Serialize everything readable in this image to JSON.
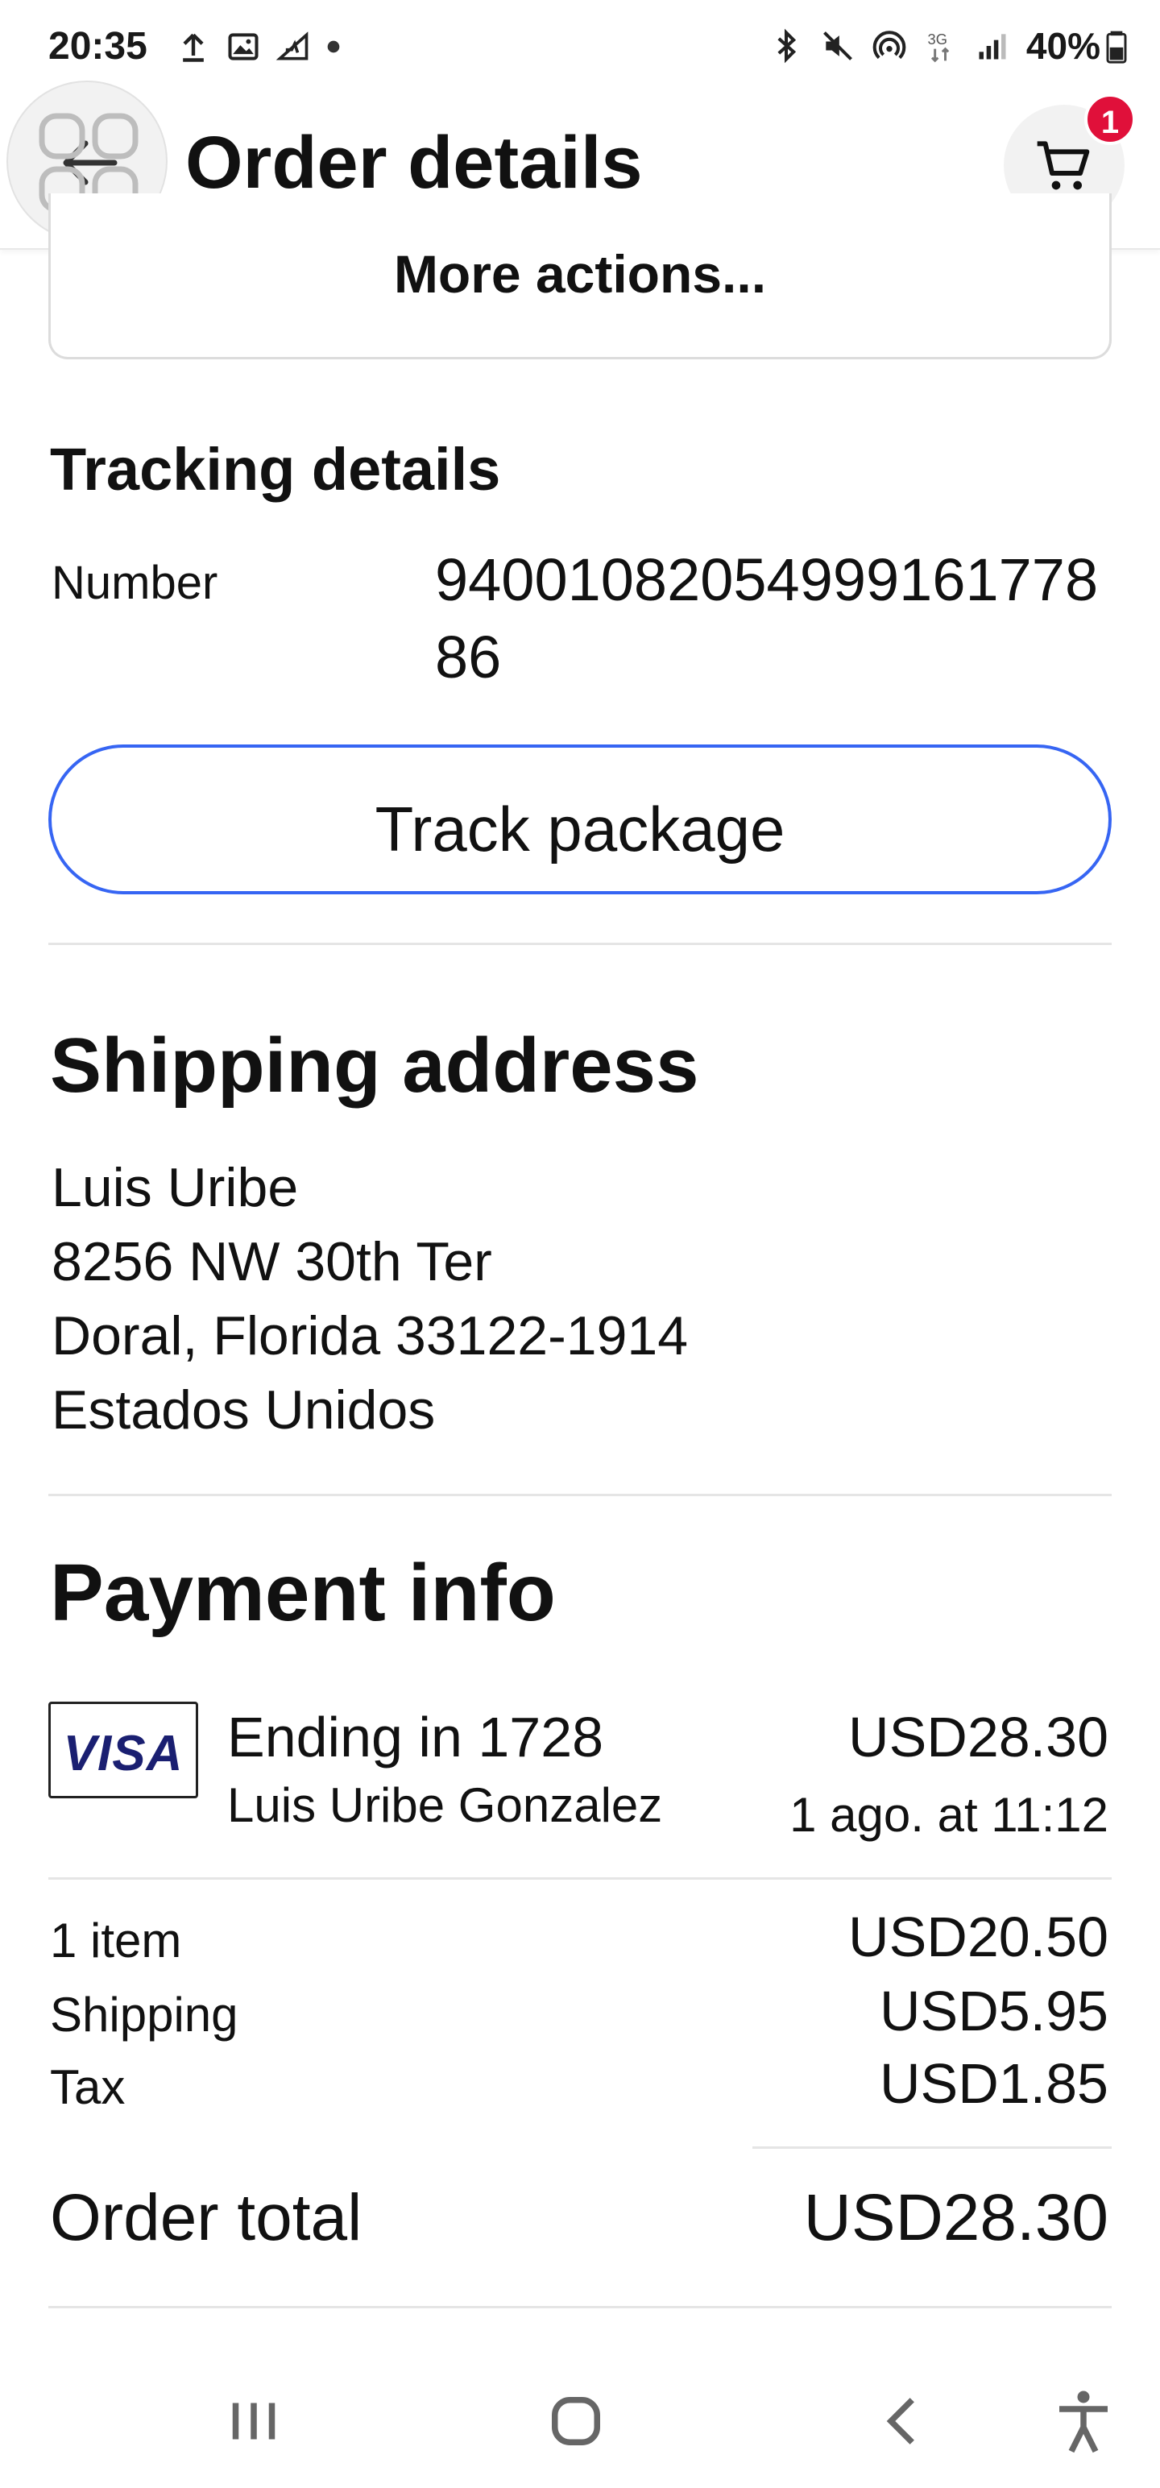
{
  "status_bar": {
    "time": "20:35",
    "battery": "40%",
    "network": "3G",
    "left_icons": [
      "upload-icon",
      "image-icon",
      "signal-pulse-icon",
      "dot-icon"
    ],
    "right_icons": [
      "bluetooth-icon",
      "mute-icon",
      "hotspot-icon",
      "network-3g-icon",
      "signal-bars-icon",
      "battery-icon"
    ]
  },
  "header": {
    "title": "Order details",
    "cart_count": "1"
  },
  "more_actions": {
    "label": "More actions..."
  },
  "tracking": {
    "title": "Tracking details",
    "number_label": "Number",
    "number": "9400108205499916177886",
    "track_button": "Track package"
  },
  "shipping": {
    "title": "Shipping address",
    "lines": [
      "Luis Uribe",
      "8256 NW 30th Ter",
      "Doral, Florida 33122-1914",
      "Estados Unidos"
    ]
  },
  "payment": {
    "title": "Payment info",
    "card_brand": "VISA",
    "ending": "Ending in 1728",
    "card_holder": "Luis  Uribe Gonzalez",
    "amount": "USD28.30",
    "date": "1 ago. at 11:12"
  },
  "summary": {
    "rows": [
      {
        "label": "1 item",
        "value": "USD20.50"
      },
      {
        "label": "Shipping",
        "value": "USD5.95"
      },
      {
        "label": "Tax",
        "value": "USD1.85"
      }
    ],
    "total_label": "Order total",
    "total_value": "USD28.30"
  },
  "nav_bar": {
    "items": [
      "recent-apps-icon",
      "home-icon",
      "back-icon",
      "accessibility-icon"
    ]
  },
  "colors": {
    "accent": "#3665f3",
    "badge": "#e0103a",
    "visa": "#1a1f71",
    "divider": "#e5e5e5"
  }
}
